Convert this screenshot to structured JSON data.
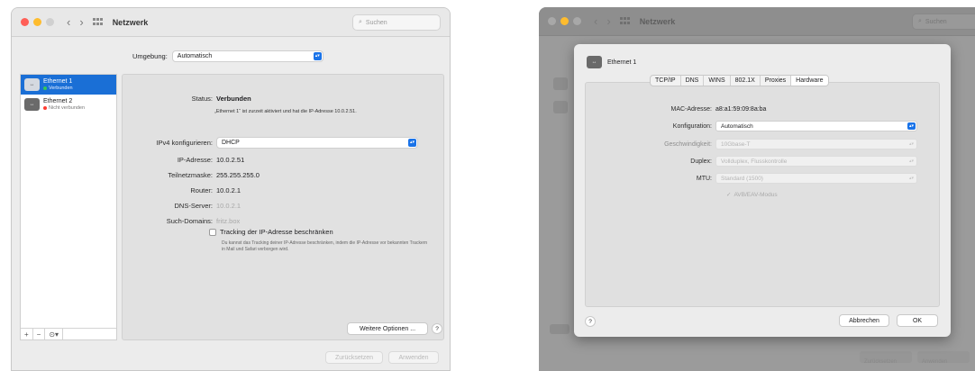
{
  "left": {
    "title": "Netzwerk",
    "search_placeholder": "Suchen",
    "umgebung_label": "Umgebung:",
    "umgebung_value": "Automatisch",
    "interfaces": [
      {
        "name": "Ethernet 1",
        "status": "Verbunden",
        "status_color": "#34c759"
      },
      {
        "name": "Ethernet 2",
        "status": "Nicht verbunden",
        "status_color": "#ff3b30"
      }
    ],
    "status_label": "Status:",
    "status_value": "Verbunden",
    "status_desc": "„Ethernet 1“ ist zurzeit aktiviert und hat die IP-Adresse 10.0.2.51.",
    "ipv4_label": "IPv4 konfigurieren:",
    "ipv4_value": "DHCP",
    "ip_label": "IP-Adresse:",
    "ip_value": "10.0.2.51",
    "mask_label": "Teilnetzmaske:",
    "mask_value": "255.255.255.0",
    "router_label": "Router:",
    "router_value": "10.0.2.1",
    "dns_label": "DNS-Server:",
    "dns_value": "10.0.2.1",
    "domains_label": "Such-Domains:",
    "domains_value": "fritz.box",
    "tracking_label": "Tracking der IP-Adresse beschränken",
    "tracking_desc": "Du kannst das Tracking deiner IP-Adresse beschränken, indem die IP-Adresse vor bekannten Trackern in Mail und Safari verborgen wird.",
    "more_button": "Weitere Optionen ...",
    "help": "?",
    "revert_button": "Zurücksetzen",
    "apply_button": "Anwenden",
    "footer_add": "+",
    "footer_remove": "−",
    "footer_action": "⊙▾"
  },
  "right": {
    "title": "Netzwerk",
    "search_placeholder": "Suchen",
    "sheet_title": "Ethernet 1",
    "tabs": [
      "TCP/IP",
      "DNS",
      "WINS",
      "802.1X",
      "Proxies",
      "Hardware"
    ],
    "active_tab": "Hardware",
    "mac_label": "MAC-Adresse:",
    "mac_value": "a8:a1:59:09:8a:ba",
    "config_label": "Konfiguration:",
    "config_value": "Automatisch",
    "speed_label": "Geschwindigkeit:",
    "speed_value": "10Gbase-T",
    "duplex_label": "Duplex:",
    "duplex_value": "Vollduplex, Flusskontrolle",
    "mtu_label": "MTU:",
    "mtu_value": "Standard (1500)",
    "avb_label": "AVB/EAV-Modus",
    "help": "?",
    "cancel_button": "Abbrechen",
    "ok_button": "OK",
    "revert_button": "Zurücksetzen",
    "apply_button": "Anwenden"
  },
  "colors": {
    "accent": "#1a73e8",
    "close": "#ff5f57",
    "minimize": "#febc2e",
    "zoom": "#d0d0d0"
  }
}
